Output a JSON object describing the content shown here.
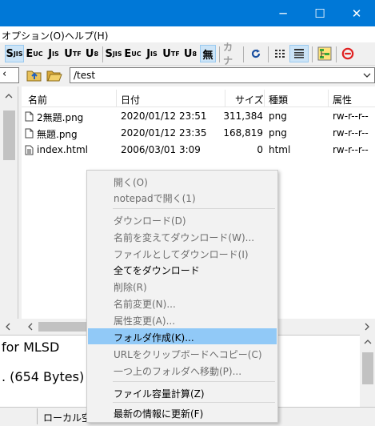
{
  "window": {
    "minimize_glyph": "─",
    "maximize_glyph": "☐",
    "close_glyph": "✕"
  },
  "menubar": {
    "items": [
      "オプション(O)",
      "ヘルプ(H)"
    ]
  },
  "toolbar": {
    "buttons": [
      "S",
      "E",
      "J",
      "U",
      "U",
      "S",
      "E",
      "J",
      "U",
      "U",
      "無",
      "カナ"
    ],
    "subs": [
      "JIS",
      "UC",
      "IS",
      "TF",
      "8",
      "JIS",
      "UC",
      "IS",
      "TF",
      "8"
    ]
  },
  "toolbar2": {
    "left_combo_arrow": "‹",
    "path": "/test"
  },
  "file_list": {
    "columns": [
      "名前",
      "日付",
      "サイズ",
      "種類",
      "属性"
    ],
    "rows": [
      {
        "name": "2無題.png",
        "date": "2020/01/12 23:51",
        "size": "311,384",
        "type": "png",
        "attr": "rw-r--r--"
      },
      {
        "name": "無題.png",
        "date": "2020/01/12 23:35",
        "size": "168,819",
        "type": "png",
        "attr": "rw-r--r--"
      },
      {
        "name": "index.html",
        "date": "2006/03/01  3:09",
        "size": "0",
        "type": "html",
        "attr": "rw-r--r--"
      }
    ]
  },
  "log": {
    "lines": [
      "for MLSD",
      ". (654 Bytes)"
    ]
  },
  "status": {
    "left": "ローカル空"
  },
  "context_menu": {
    "items": [
      {
        "label": "開く(O)",
        "enabled": false
      },
      {
        "label": "notepadで開く(1)",
        "enabled": false
      },
      {
        "label": "ダウンロード(D)",
        "enabled": false
      },
      {
        "label": "名前を変えてダウンロード(W)...",
        "enabled": false
      },
      {
        "label": "ファイルとしてダウンロード(I)",
        "enabled": false
      },
      {
        "label": "全てをダウンロード",
        "enabled": true
      },
      {
        "label": "削除(R)",
        "enabled": false
      },
      {
        "label": "名前変更(N)...",
        "enabled": false
      },
      {
        "label": "属性変更(A)...",
        "enabled": false
      },
      {
        "label": "フォルダ作成(K)...",
        "enabled": true,
        "highlighted": true
      },
      {
        "label": "URLをクリップボードへコピー(C)",
        "enabled": false
      },
      {
        "label": "一つ上のフォルダへ移動(P)...",
        "enabled": false
      },
      {
        "label": "ファイル容量計算(Z)",
        "enabled": true
      },
      {
        "label": "最新の情報に更新(F)",
        "enabled": true
      }
    ]
  }
}
